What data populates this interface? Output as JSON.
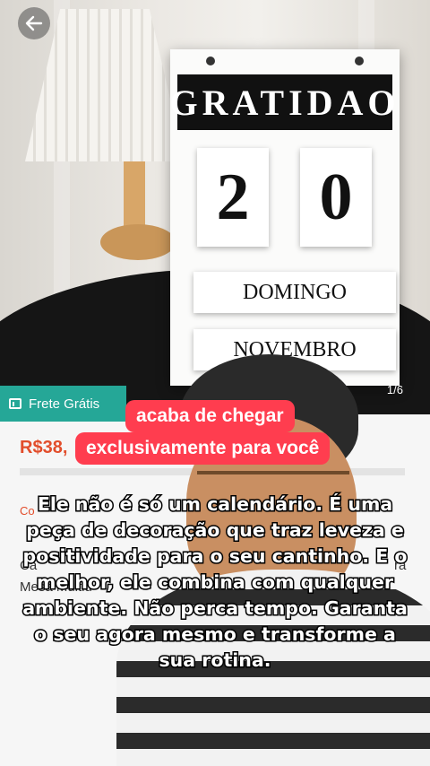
{
  "calendar": {
    "header": "GRATIDAO",
    "day_digit_1": "2",
    "day_digit_2": "0",
    "weekday": "DOMINGO",
    "month": "NOVEMBRO"
  },
  "gallery": {
    "counter": "1/6"
  },
  "product": {
    "shipping_badge": "Frete Grátis",
    "price": "R$38,",
    "partial_text_1": "Co",
    "partial_text_2": "Ca",
    "partial_text_3": "Mesa Multiu",
    "partial_text_4": "ra"
  },
  "overlay": {
    "tag_1": "acaba de chegar",
    "tag_2": "exclusivamente para você",
    "caption": "Ele não é só um calendário. É uma peça de decoração que traz leveza e positividade para o seu cantinho. E o melhor, ele combina com qualquer ambiente. Não perca tempo. Garanta o seu agora mesmo e transforme a sua rotina."
  },
  "colors": {
    "shipping_badge": "#25a797",
    "price": "#e24d2b",
    "tag": "#ff3d4f"
  },
  "icons": {
    "back": "back-arrow-icon",
    "shipping": "ticket-icon"
  }
}
